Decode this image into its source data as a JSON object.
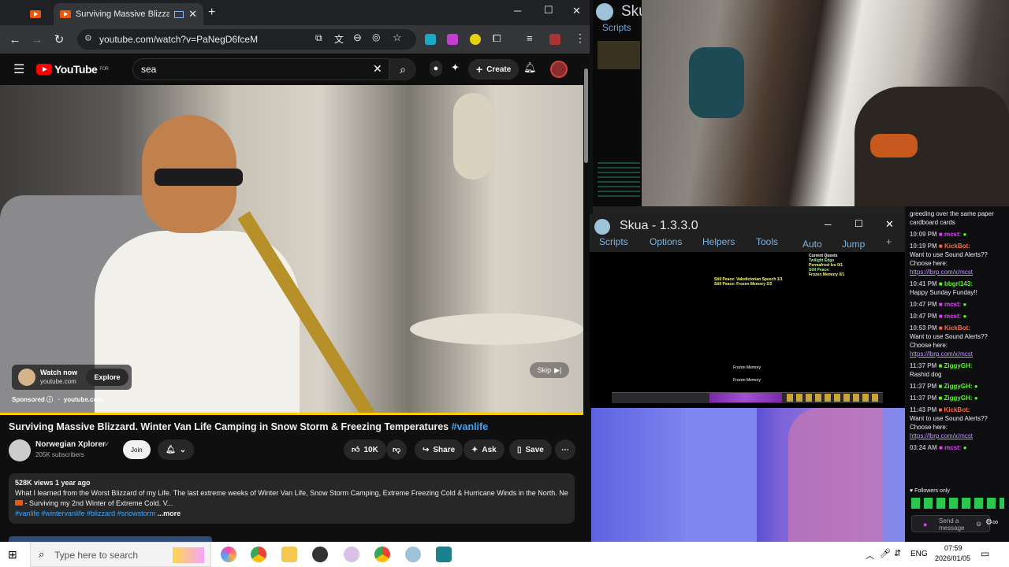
{
  "browser": {
    "tabs": [
      {
        "label": ""
      },
      {
        "label": "Surviving Massive Blizzard."
      }
    ],
    "url": "youtube.com/watch?v=PaNegD6fceM"
  },
  "youtube": {
    "logo": "YouTube",
    "region": "FOR",
    "search_value": "sea",
    "create_label": "Create",
    "ad": {
      "watch_now": "Watch now",
      "domain": "youtube.com",
      "explore": "Explore",
      "sponsored": "Sponsored",
      "sponsor_domain": "youtube.com",
      "skip": "Skip"
    },
    "title": "Surviving Massive Blizzard. Winter Van Life Camping in Snow Storm & Freezing Temperatures",
    "hashtag": "#vanlife",
    "channel": {
      "name": "Norwegian Xplorer",
      "subs": "205K subscribers",
      "join": "Join"
    },
    "actions": {
      "likes": "10K",
      "share": "Share",
      "ask": "Ask",
      "save": "Save"
    },
    "desc": {
      "meta": "528K views  1 year ago",
      "line1": "What I learned from the Worst Blizzard of my Life. The last extreme weeks of Winter Van Life, Snow Storm Camping, Extreme Freezing Cold & Hurricane Winds in the North. Next:",
      "line2": "- Surviving my 2nd Winter of Extreme Cold. V...",
      "tags": "#vanlife #wintervanlife #blizzard #snowstorm",
      "more": "...more"
    }
  },
  "skua": {
    "title": "Skua - 1.3.3.0",
    "mini_title": "Sku",
    "mini_menu": "Scripts",
    "menu": [
      "Scripts",
      "Options",
      "Helpers",
      "Tools",
      "Auto",
      "Jump",
      "+"
    ],
    "quest_header": "Current Quests",
    "quest_lines": [
      "Twilight Edge",
      "Permafrost Ice 0/1",
      "Still Peace:",
      "Frozen Memory 0/1"
    ],
    "log1": "Still Peace: Valedictorian Speech 1/1",
    "log2": "Still Peace: Frozen Memory 2/2",
    "npc1": "Frozen Memory",
    "npc2": "Frozen Memory"
  },
  "chat": {
    "intro": "greeding over the same paper cardboard cards",
    "messages": [
      {
        "time": "10:09 PM",
        "user": "mcst",
        "text": ""
      },
      {
        "time": "10:19 PM",
        "user": "KickBot",
        "text": "Want to use Sound Alerts?? Choose here:",
        "link": "https://lbrp.com/x/mcst"
      },
      {
        "time": "10:41 PM",
        "user": "bbgrl143",
        "text": "Happy Sunday Funday!!"
      },
      {
        "time": "10:47 PM",
        "user": "mcst",
        "text": ""
      },
      {
        "time": "10:47 PM",
        "user": "mcst",
        "text": ""
      },
      {
        "time": "10:53 PM",
        "user": "KickBot",
        "text": "Want to use Sound Alerts?? Choose here:",
        "link": "https://lbrp.com/x/mcst"
      },
      {
        "time": "11:37 PM",
        "user": "ZiggyGH",
        "text": "Rashid dog"
      },
      {
        "time": "11:37 PM",
        "user": "ZiggyGH",
        "text": ""
      },
      {
        "time": "11:37 PM",
        "user": "ZiggyGH",
        "text": ""
      },
      {
        "time": "11:43 PM",
        "user": "KickBot",
        "text": "Want to use Sound Alerts?? Choose here:",
        "link": "https://lbrp.com/x/mcst"
      },
      {
        "time": "03:24 AM",
        "user": "mcst",
        "text": ""
      }
    ],
    "followers_only": "Followers only",
    "placeholder": "Send a message"
  },
  "taskbar": {
    "search_placeholder": "Type here to search",
    "lang": "ENG",
    "time": "07:59",
    "date": "2026/01/05"
  },
  "colors": {
    "accent_yellow": "#ffcc00",
    "yt_red": "#ff0000",
    "kick_green": "#53fc18"
  }
}
